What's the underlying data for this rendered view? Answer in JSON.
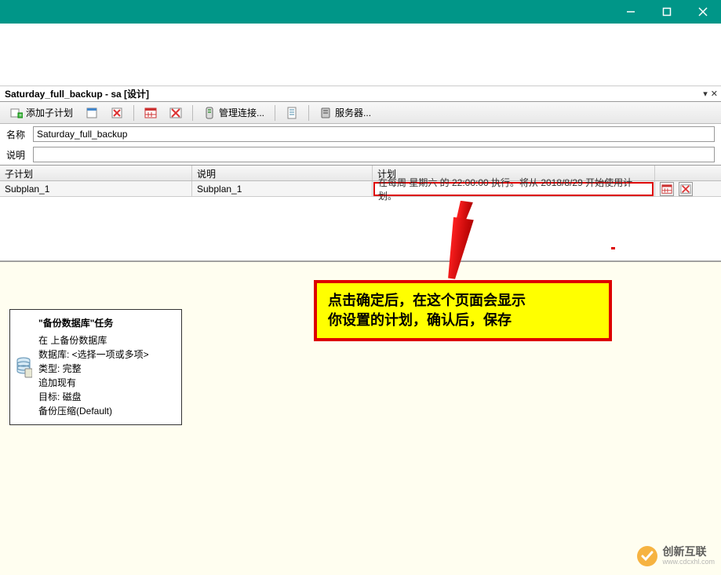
{
  "titlebar": {
    "minimize": "—",
    "maximize": "☐",
    "close": "✕"
  },
  "tab": {
    "title": "Saturday_full_backup - sa [设计]"
  },
  "toolbar": {
    "add_subplan": "添加子计划",
    "manage_conn": "管理连接...",
    "servers": "服务器..."
  },
  "form": {
    "name_label": "名称",
    "name_value": "Saturday_full_backup",
    "desc_label": "说明",
    "desc_value": ""
  },
  "grid": {
    "headers": {
      "subplan": "子计划",
      "desc": "说明",
      "plan": "计划"
    },
    "row": {
      "subplan": "Subplan_1",
      "desc": "Subplan_1",
      "schedule": "在每周 星期六 的 22:00:00 执行。将从 2018/8/29 开始使用计划。"
    }
  },
  "task_box": {
    "title": "\"备份数据库\"任务",
    "lines": [
      "在 上备份数据库",
      "数据库: <选择一项或多项>",
      "类型: 完整",
      "追加现有",
      "目标: 磁盘",
      "备份压缩(Default)"
    ]
  },
  "annotation": {
    "text_line1": "点击确定后，在这个页面会显示",
    "text_line2": "你设置的计划，确认后，保存"
  },
  "watermark": {
    "brand": "创新互联",
    "url": "www.cdcxhl.com"
  }
}
